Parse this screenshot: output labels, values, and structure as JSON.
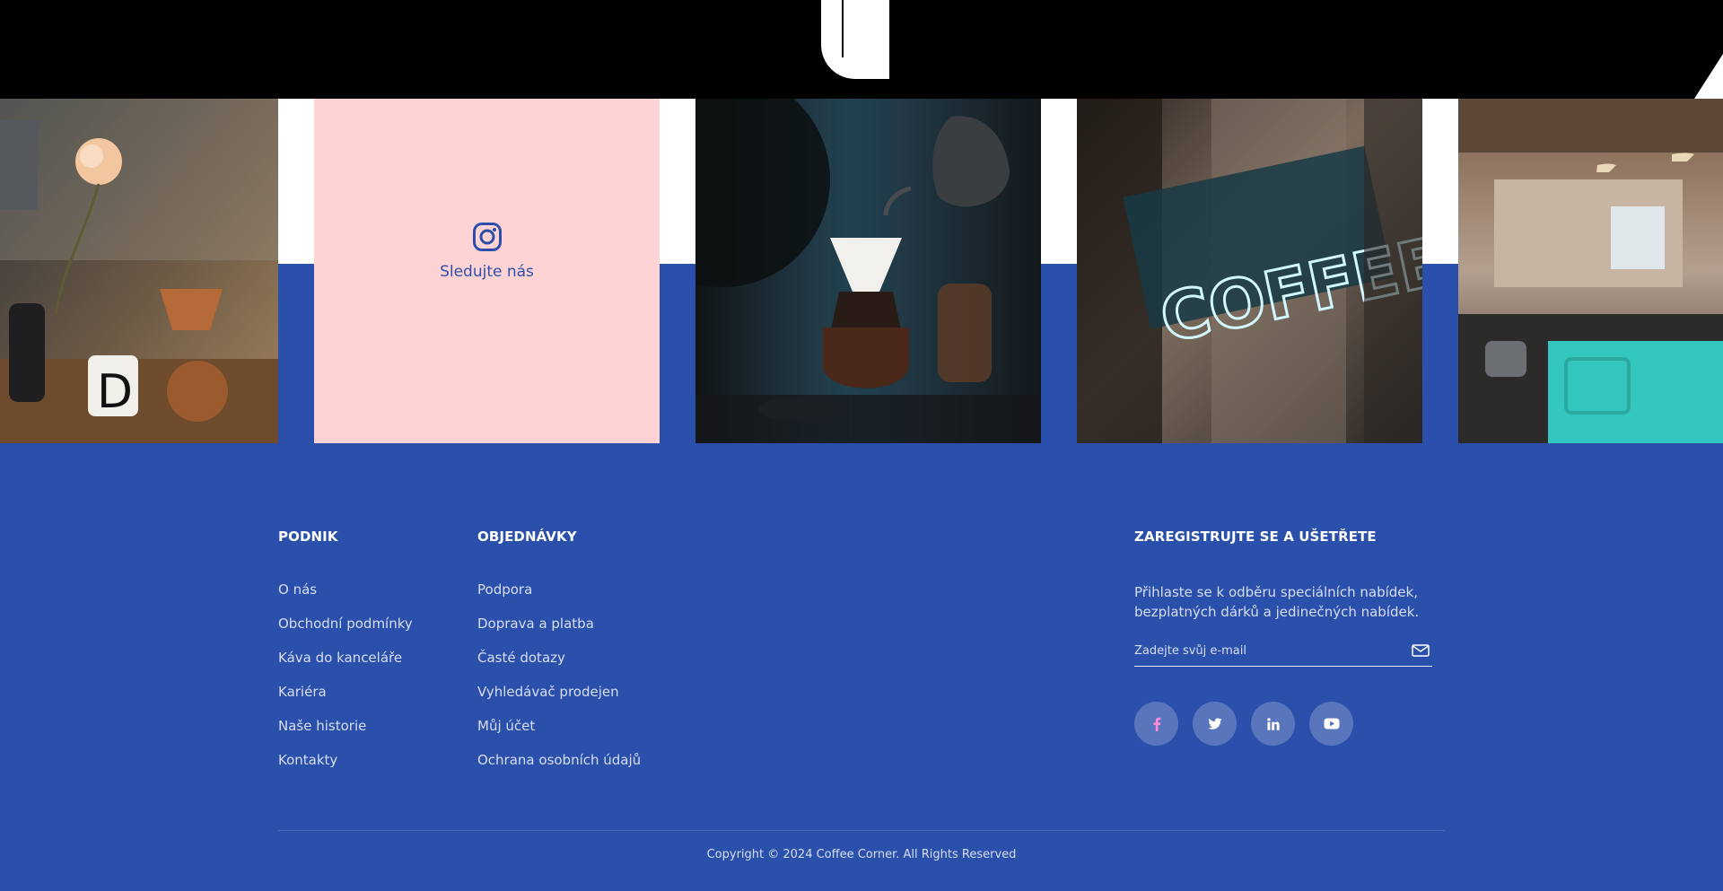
{
  "instagram_strip": {
    "photos": [
      {
        "alt": "coffee-setup-photo"
      },
      {
        "alt": "pour-over-photo"
      },
      {
        "alt": "neon-coffee-sign-photo"
      },
      {
        "alt": "cafe-interior-photo"
      }
    ],
    "follow_label": "Sledujte nás"
  },
  "footer": {
    "company": {
      "title": "PODNIK",
      "links": [
        "O nás",
        "Obchodní podmínky",
        "Káva do kanceláře",
        "Kariéra",
        "Naše historie",
        "Kontakty"
      ]
    },
    "orders": {
      "title": "OBJEDNÁVKY",
      "links": [
        "Podpora",
        "Doprava a platba",
        "Časté dotazy",
        "Vyhledávač prodejen",
        "Můj účet",
        "Ochrana osobních údajů"
      ]
    },
    "signup": {
      "title": "ZAREGISTRUJTE SE A UŠETŘETE",
      "text": "Přihlaste se k odběru speciálních nabídek, bezplatných dárků a jedinečných nabídek.",
      "email_placeholder": "Zadejte svůj e-mail"
    },
    "socials": [
      {
        "icon": "facebook-icon"
      },
      {
        "icon": "twitter-icon"
      },
      {
        "icon": "linkedin-icon"
      },
      {
        "icon": "youtube-icon"
      }
    ],
    "copyright": "Copyright © 2024 Coffee Corner. All Rights Reserved"
  },
  "colors": {
    "brand_blue": "#2b50ab",
    "instagram_tile_pink": "#ffd3d3",
    "facebook_pink": "#ff8ad8"
  }
}
